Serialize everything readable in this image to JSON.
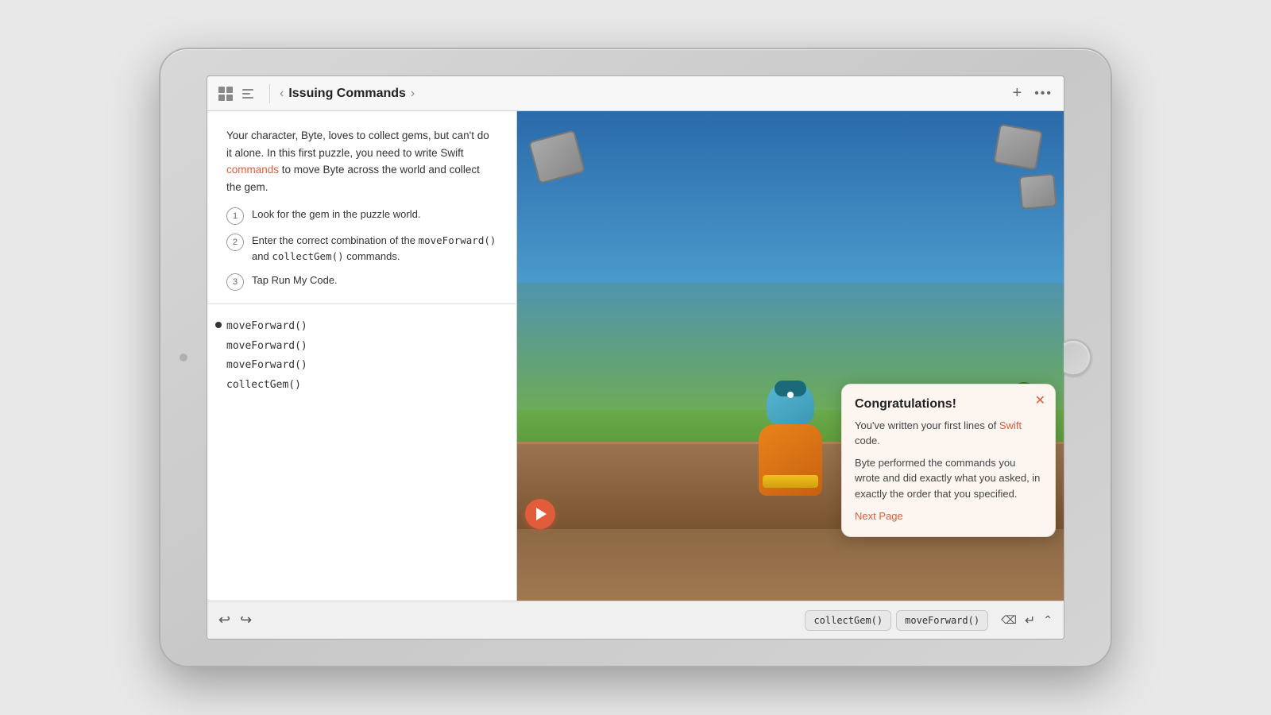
{
  "ipad": {
    "screen": {
      "toolbar": {
        "title": "Issuing Commands",
        "nav_back": "‹",
        "nav_forward": "›",
        "plus": "+",
        "more": "•••"
      },
      "instructions": {
        "body": "Your character, Byte, loves to collect gems, but can't do it alone. In this first puzzle, you need to write Swift ",
        "swift_word": "commands",
        "body2": " to move Byte across the world and collect the gem.",
        "steps": [
          {
            "number": "1",
            "text": "Look for the gem in the puzzle world."
          },
          {
            "number": "2",
            "text_pre": "Enter the correct combination of the ",
            "code1": "moveForward()",
            "text_mid": " and ",
            "code2": "collectGem()",
            "text_post": " commands."
          },
          {
            "number": "3",
            "text": "Tap Run My Code."
          }
        ]
      },
      "code": {
        "lines": [
          "moveForward()",
          "moveForward()",
          "moveForward()",
          "collectGem()"
        ]
      },
      "congrats": {
        "title": "Congratulations!",
        "line1_pre": "You've written your first lines of ",
        "swift_word": "Swift",
        "line1_post": " code.",
        "line2": "Byte performed the commands you wrote and did exactly what you asked, in exactly the order that you specified.",
        "next_page": "Next Page"
      },
      "bottom_toolbar": {
        "keyword1": "collectGem()",
        "keyword2": "moveForward()"
      }
    }
  }
}
